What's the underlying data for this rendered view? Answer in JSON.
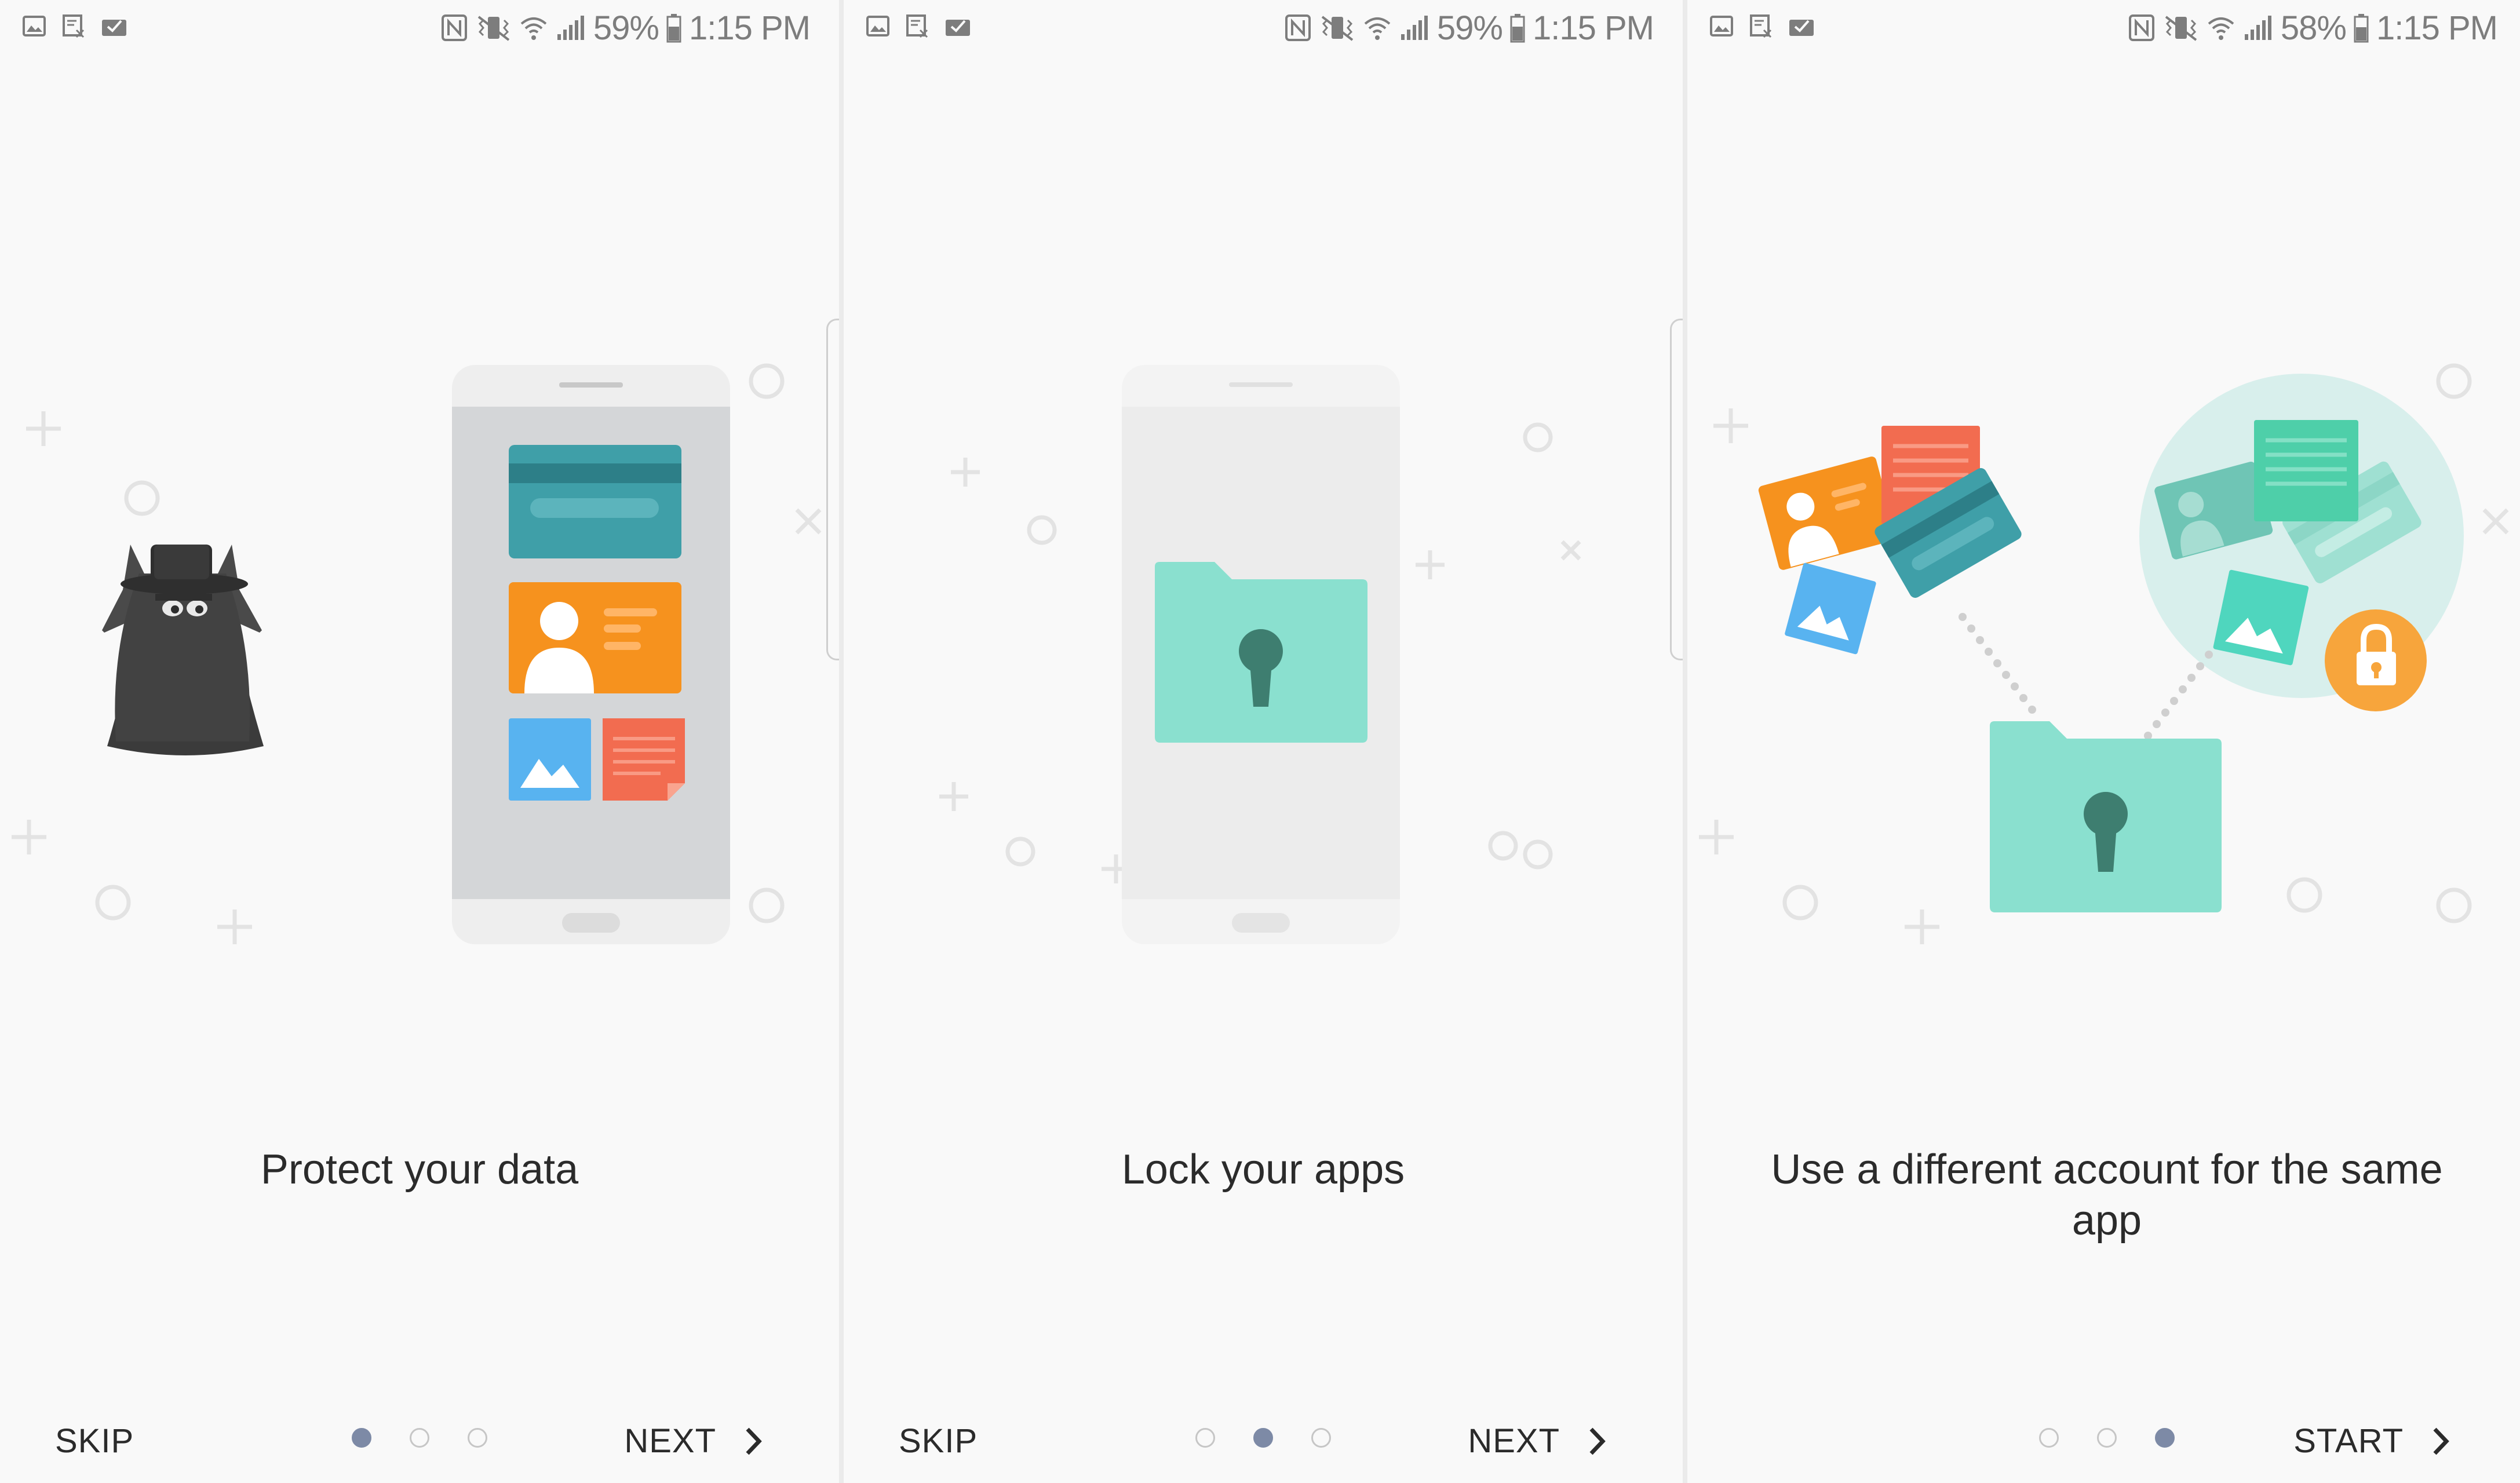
{
  "screens": [
    {
      "status": {
        "battery": "59%",
        "time": "1:15 PM"
      },
      "title": "Protect your data",
      "left_button": "SKIP",
      "right_button": "NEXT",
      "active_dot": 0
    },
    {
      "status": {
        "battery": "59%",
        "time": "1:15 PM"
      },
      "title": "Lock your apps",
      "left_button": "SKIP",
      "right_button": "NEXT",
      "active_dot": 1
    },
    {
      "status": {
        "battery": "58%",
        "time": "1:15 PM"
      },
      "title": "Use a different account for the same app",
      "left_button": "",
      "right_button": "START",
      "active_dot": 2
    }
  ],
  "icons": {
    "statusbar_left": [
      "gallery-notification-icon",
      "screenshot-notification-icon",
      "task-notification-icon"
    ],
    "statusbar_right": [
      "nfc-icon",
      "vibrate-icon",
      "wifi-icon",
      "signal-icon",
      "battery-icon"
    ],
    "navigation": "chevron-right-icon",
    "illustrations": [
      "spy-icon",
      "phone-icon",
      "locked-folder-icon",
      "lock-icon"
    ]
  },
  "colors": {
    "background": "#f9f9f9",
    "text": "#2b2b2b",
    "active_dot": "#7d8aa6",
    "teal": "#8ae0cf",
    "orange": "#f99a2c",
    "card_blue": "#3f9fa8",
    "red_doc": "#f26c50",
    "photo_blue": "#58b3f0"
  }
}
